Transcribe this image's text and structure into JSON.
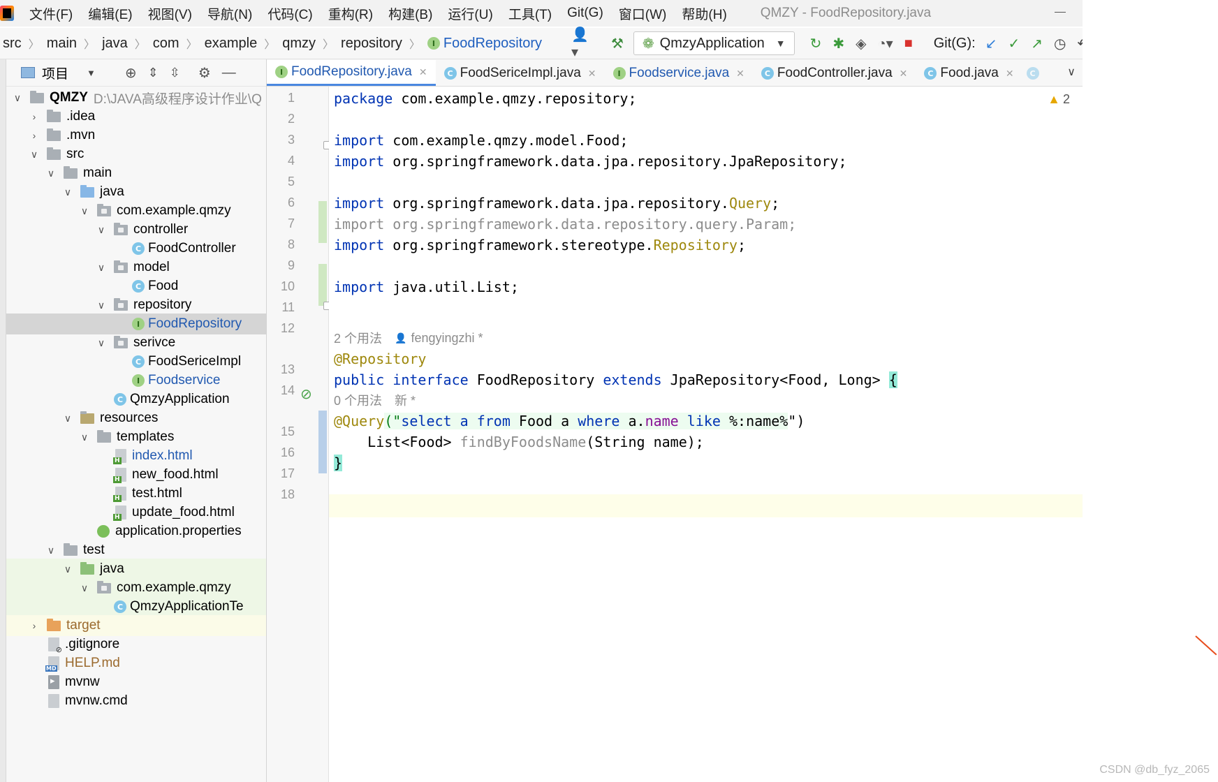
{
  "window": {
    "title": "QMZY - FoodRepository.java"
  },
  "menu": [
    "文件(F)",
    "编辑(E)",
    "视图(V)",
    "导航(N)",
    "代码(C)",
    "重构(R)",
    "构建(B)",
    "运行(U)",
    "工具(T)",
    "Git(G)",
    "窗口(W)",
    "帮助(H)"
  ],
  "breadcrumb": [
    "src",
    "main",
    "java",
    "com",
    "example",
    "qmzy",
    "repository",
    "FoodRepository"
  ],
  "toolbar": {
    "run_config": "QmzyApplication",
    "git_label": "Git(G):"
  },
  "project": {
    "header": "项目",
    "root_name": "QMZY",
    "root_path": "D:\\JAVA高级程序设计作业\\Q",
    "rows": [
      {
        "label": ".idea"
      },
      {
        "label": ".mvn"
      },
      {
        "label": "src"
      },
      {
        "label": "main"
      },
      {
        "label": "java"
      },
      {
        "label": "com.example.qmzy"
      },
      {
        "label": "controller"
      },
      {
        "label": "FoodController"
      },
      {
        "label": "model"
      },
      {
        "label": "Food"
      },
      {
        "label": "repository"
      },
      {
        "label": "FoodRepository"
      },
      {
        "label": "serivce"
      },
      {
        "label": "FoodSericeImpl"
      },
      {
        "label": "Foodservice"
      },
      {
        "label": "QmzyApplication"
      },
      {
        "label": "resources"
      },
      {
        "label": "templates"
      },
      {
        "label": "index.html"
      },
      {
        "label": "new_food.html"
      },
      {
        "label": "test.html"
      },
      {
        "label": "update_food.html"
      },
      {
        "label": "application.properties"
      },
      {
        "label": "test"
      },
      {
        "label": "java"
      },
      {
        "label": "com.example.qmzy"
      },
      {
        "label": "QmzyApplicationTe"
      },
      {
        "label": "target"
      },
      {
        "label": ".gitignore"
      },
      {
        "label": "HELP.md"
      },
      {
        "label": "mvnw"
      },
      {
        "label": "mvnw.cmd"
      }
    ]
  },
  "tabs": [
    {
      "label": "FoodRepository.java",
      "badge": "I"
    },
    {
      "label": "FoodSericeImpl.java",
      "badge": "C"
    },
    {
      "label": "Foodservice.java",
      "badge": "I"
    },
    {
      "label": "FoodController.java",
      "badge": "C"
    },
    {
      "label": "Food.java",
      "badge": "C"
    }
  ],
  "editor": {
    "warnings": "2",
    "line_numbers": [
      "1",
      "2",
      "3",
      "4",
      "5",
      "6",
      "7",
      "8",
      "9",
      "10",
      "11",
      "12",
      "13",
      "14",
      "15",
      "16",
      "17",
      "18"
    ],
    "l1_kw": "package",
    "l1_rest": " com.example.qmzy.repository;",
    "l3_kw": "import",
    "l3_rest": " com.example.qmzy.model.Food;",
    "l4_kw": "import",
    "l4_rest": " org.springframework.data.jpa.repository.JpaRepository;",
    "l6_kw": "import",
    "l6_rest": " org.springframework.data.jpa.repository.",
    "l6_ann": "Query",
    "l6_end": ";",
    "l7": "import org.springframework.data.repository.query.Param;",
    "l8_kw": "import",
    "l8_rest": " org.springframework.stereotype.",
    "l8_ann": "Repository",
    "l8_end": ";",
    "l10_kw": "import",
    "l10_rest": " java.util.List;",
    "inlay1_usages": "2 个用法",
    "inlay1_author": "fengyingzhi *",
    "l13": "@Repository",
    "l14_kw1": "public",
    "l14_kw2": "interface",
    "l14_name": " FoodRepository ",
    "l14_kw3": "extends",
    "l14_rest": " JpaRepository<Food, Long> ",
    "l14_brace": "{",
    "inlay2_usages": "0 个用法",
    "inlay2_new": "新 *",
    "l15_ann": "@Query",
    "l15_open": "(\"",
    "l15_s1": "select a ",
    "l15_from": "from",
    "l15_s2": " Food a ",
    "l15_where": "where",
    "l15_s3": " a.",
    "l15_name": "name",
    "l15_s4": " ",
    "l15_like": "like",
    "l15_s5": " %:name%",
    "l15_close": "\")",
    "l16_a": "    List<Food> ",
    "l16_m": "findByFoodsName",
    "l16_b": "(String name);",
    "l17": "}"
  },
  "watermark": "CSDN @db_fyz_2065"
}
